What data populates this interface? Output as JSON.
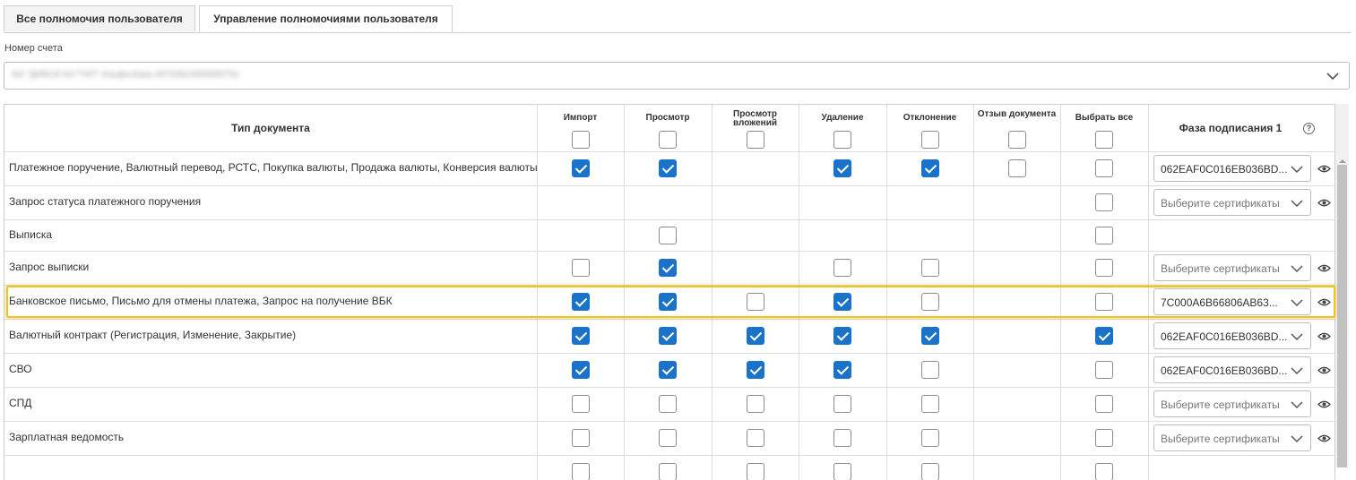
{
  "tabs": [
    {
      "label": "Все полномочия пользователя",
      "active": false
    },
    {
      "label": "Управление полномочиями пользователя",
      "active": true
    }
  ],
  "account": {
    "label": "Номер счета",
    "value": "АО \"ДИКСИ Юг\"ТКП\" Альфа-Банк 40702810000000761"
  },
  "table": {
    "doc_type_header": "Тип документа",
    "columns": [
      {
        "key": "import",
        "label": "Импорт"
      },
      {
        "key": "view",
        "label": "Просмотр"
      },
      {
        "key": "view_att",
        "label": "Просмотр вложений"
      },
      {
        "key": "delete",
        "label": "Удаление"
      },
      {
        "key": "reject",
        "label": "Отклонение"
      },
      {
        "key": "recall",
        "label": "Отзыв документа"
      },
      {
        "key": "all",
        "label": "Выбрать все"
      }
    ],
    "phase_header": "Фаза подписания 1",
    "rows": [
      {
        "name": "Платежное поручение, Валютный перевод, РСТС, Покупка валюты, Продажа валюты, Конверсия валюты",
        "cells": [
          1,
          1,
          null,
          1,
          1,
          0,
          0
        ],
        "cert": "062EAF0C016EB036BD...",
        "cert_placeholder": false
      },
      {
        "name": "Запрос статуса платежного поручения",
        "cells": [
          null,
          null,
          null,
          null,
          null,
          null,
          0
        ],
        "cert": "Выберите сертификаты",
        "cert_placeholder": true
      },
      {
        "name": "Выписка",
        "cells": [
          null,
          0,
          null,
          null,
          null,
          null,
          0
        ],
        "cert": null,
        "cert_placeholder": false
      },
      {
        "name": "Запрос выписки",
        "cells": [
          0,
          1,
          null,
          0,
          0,
          null,
          0
        ],
        "cert": "Выберите сертификаты",
        "cert_placeholder": true
      },
      {
        "name": "Банковское письмо, Письмо для отмены платежа, Запрос на получение ВБК",
        "cells": [
          1,
          1,
          0,
          1,
          0,
          null,
          0
        ],
        "cert": "7C000A6B66806AB63...",
        "cert_placeholder": false
      },
      {
        "name": "Валютный контракт (Регистрация, Изменение, Закрытие)",
        "cells": [
          1,
          1,
          1,
          1,
          1,
          null,
          1
        ],
        "cert": "062EAF0C016EB036BD...",
        "cert_placeholder": false
      },
      {
        "name": "СВО",
        "cells": [
          1,
          1,
          1,
          1,
          0,
          null,
          0
        ],
        "cert": "062EAF0C016EB036BD...",
        "cert_placeholder": false
      },
      {
        "name": "СПД",
        "cells": [
          0,
          0,
          0,
          0,
          0,
          null,
          0
        ],
        "cert": "Выберите сертификаты",
        "cert_placeholder": true
      },
      {
        "name": "Зарплатная ведомость",
        "cells": [
          0,
          0,
          0,
          0,
          0,
          null,
          0
        ],
        "cert": "Выберите сертификаты",
        "cert_placeholder": true
      },
      {
        "name": "",
        "cells": [
          0,
          0,
          0,
          0,
          0,
          null,
          0
        ],
        "cert": null,
        "cert_placeholder": false
      }
    ]
  },
  "colors": {
    "accent": "#1a73c9",
    "highlight": "#f0c419"
  },
  "icons": {
    "dropdown": "chevron-down-icon",
    "view": "eye-icon",
    "help": "help-circle-icon"
  }
}
